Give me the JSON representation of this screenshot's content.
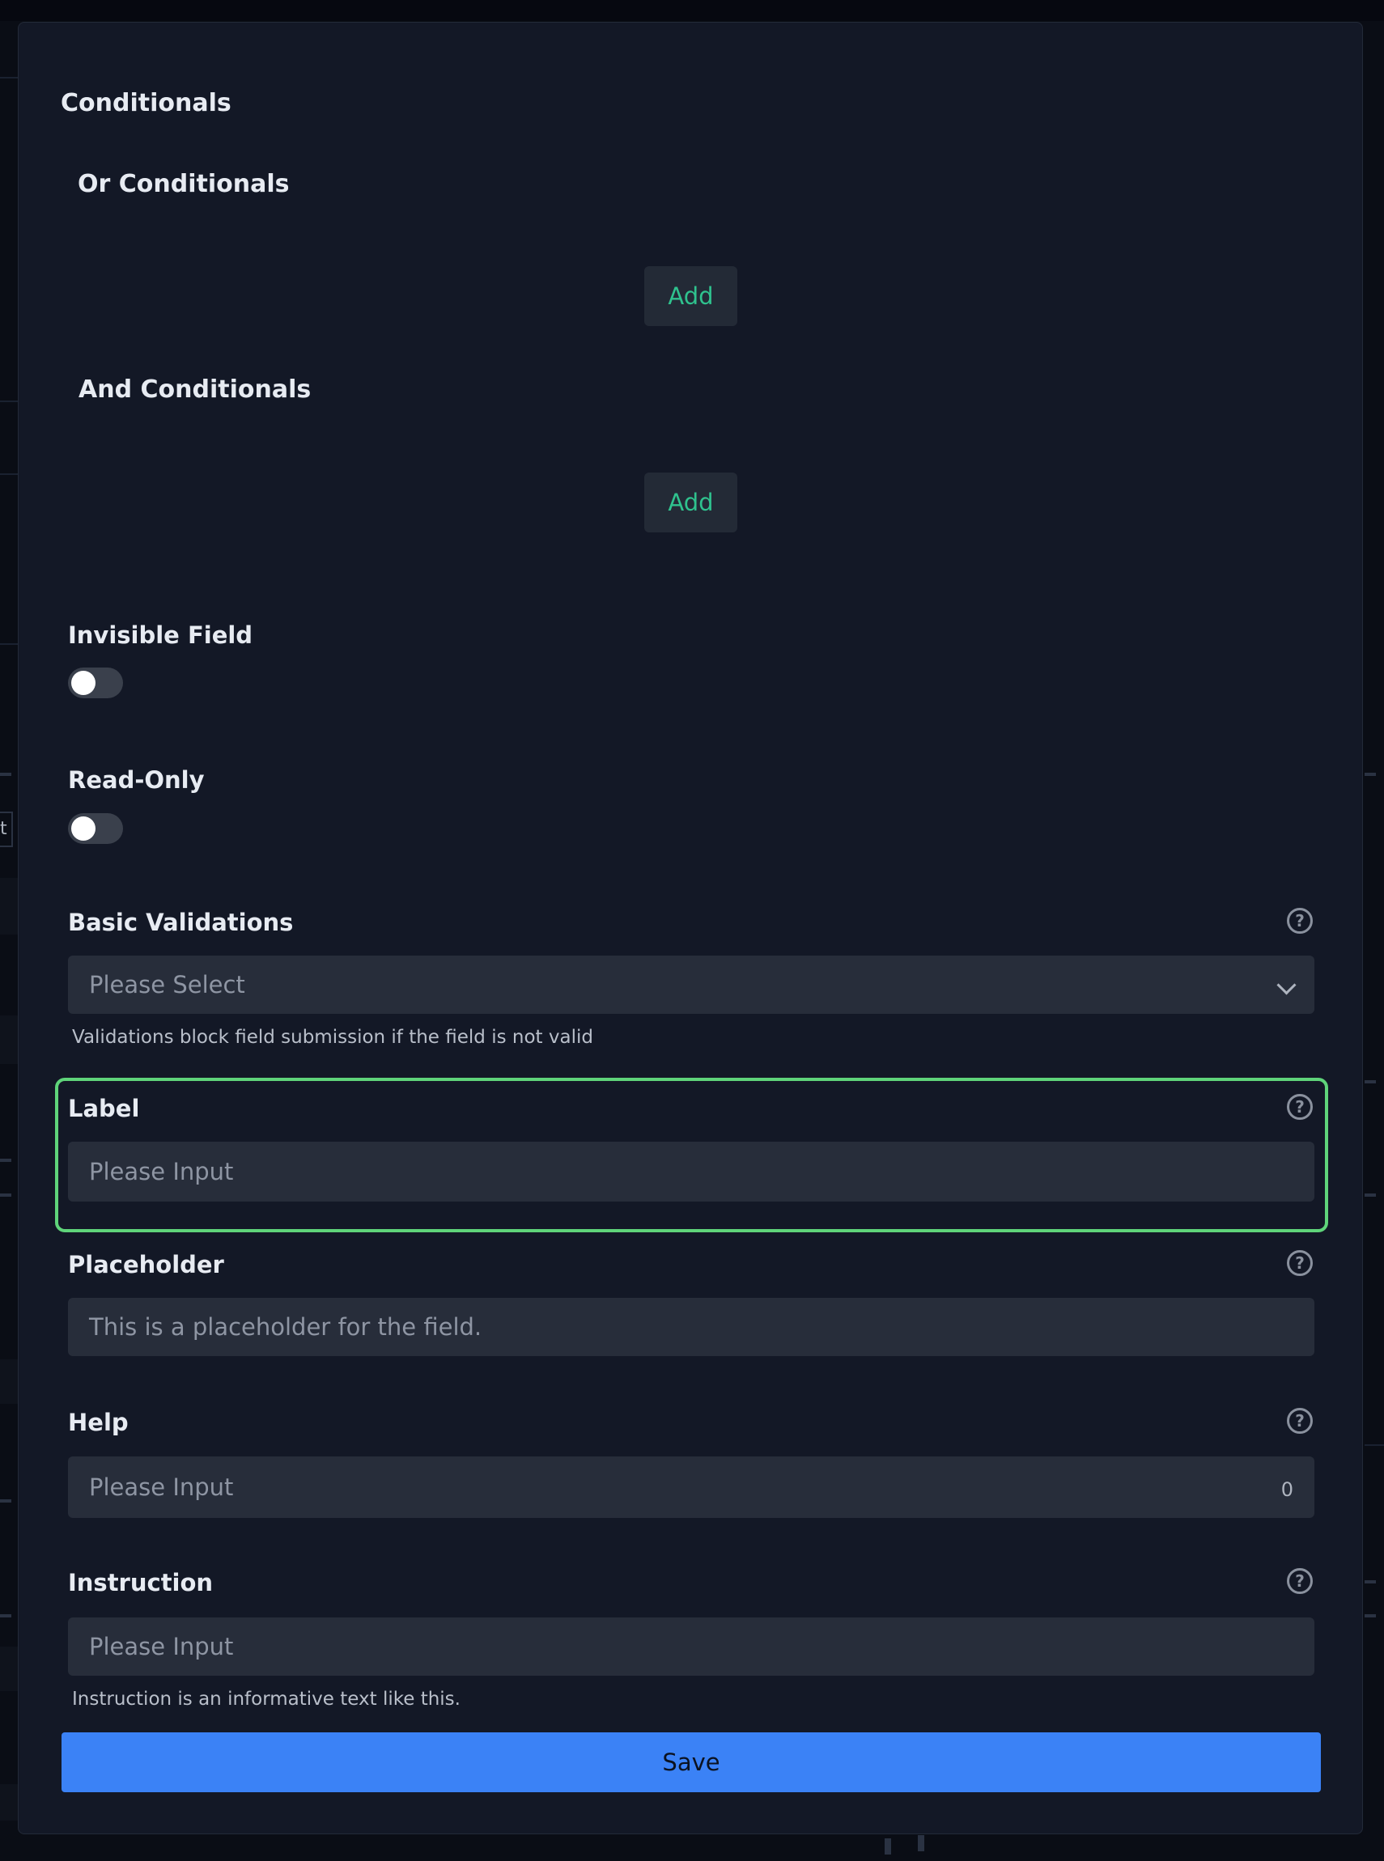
{
  "conditionals": {
    "title": "Conditionals",
    "or_title": "Or Conditionals",
    "and_title": "And Conditionals",
    "add_label": "Add"
  },
  "invisible_field": {
    "label": "Invisible Field",
    "enabled": false
  },
  "read_only": {
    "label": "Read-Only",
    "enabled": false
  },
  "basic_validations": {
    "label": "Basic Validations",
    "selected": "Please Select",
    "hint": "Validations block field submission if the field is not valid"
  },
  "label_field": {
    "label": "Label",
    "placeholder": "Please Input"
  },
  "placeholder_field": {
    "label": "Placeholder",
    "value": "This is a placeholder for the field."
  },
  "help_field": {
    "label": "Help",
    "placeholder": "Please Input",
    "count": "0"
  },
  "instruction_field": {
    "label": "Instruction",
    "placeholder": "Please Input",
    "hint": "Instruction is an informative text like this."
  },
  "save_label": "Save",
  "help_glyph": "?",
  "background_fragment": "t",
  "colors": {
    "accent": "#3b82f6",
    "add_text": "#2fc28e",
    "highlight": "#5fd47a"
  }
}
